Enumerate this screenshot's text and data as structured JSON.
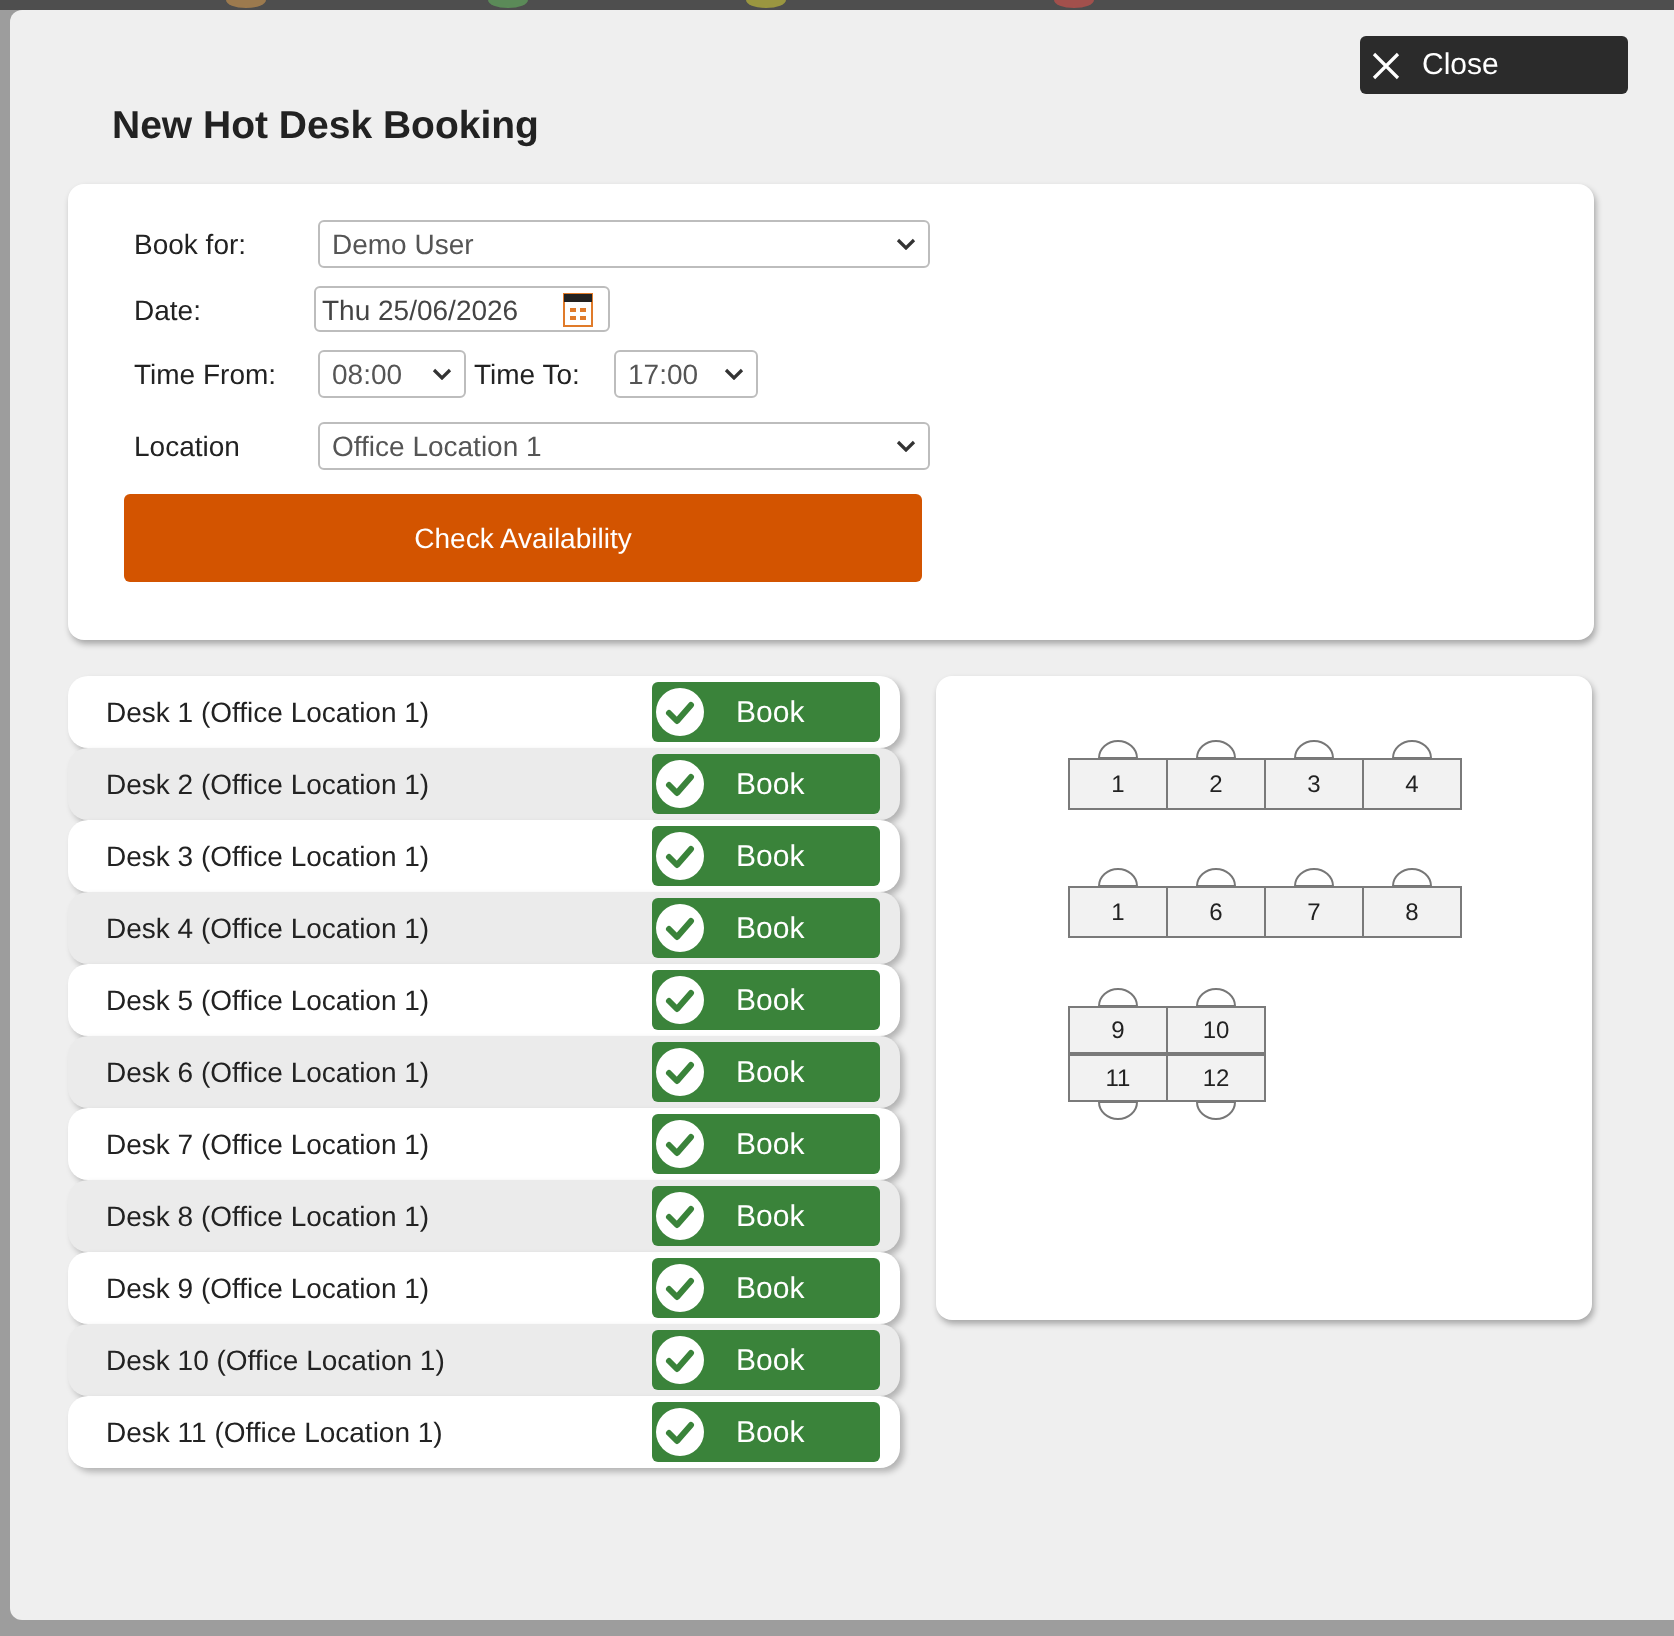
{
  "backdrop": {
    "dots": [
      {
        "color": "#9c7a4e"
      },
      {
        "color": "#5b8a58"
      },
      {
        "color": "#9a9640"
      },
      {
        "color": "#a2504c"
      }
    ]
  },
  "dialog": {
    "close_button": {
      "label": "Close"
    },
    "title": "New Hot Desk Booking"
  },
  "form": {
    "book_for": {
      "label": "Book for:",
      "value": "Demo User"
    },
    "date": {
      "label": "Date:",
      "value": "Thu 25/06/2026"
    },
    "time_from": {
      "label": "Time From:",
      "value": "08:00"
    },
    "time_to": {
      "label": "Time To:",
      "value": "17:00"
    },
    "location": {
      "label": "Location",
      "value": "Office Location 1"
    },
    "check_button": {
      "label": "Check Availability"
    }
  },
  "desks": [
    {
      "name": "Desk 1 (Office Location 1)",
      "action": "Book"
    },
    {
      "name": "Desk 2 (Office Location 1)",
      "action": "Book"
    },
    {
      "name": "Desk 3 (Office Location 1)",
      "action": "Book"
    },
    {
      "name": "Desk 4 (Office Location 1)",
      "action": "Book"
    },
    {
      "name": "Desk 5 (Office Location 1)",
      "action": "Book"
    },
    {
      "name": "Desk 6 (Office Location 1)",
      "action": "Book"
    },
    {
      "name": "Desk 7 (Office Location 1)",
      "action": "Book"
    },
    {
      "name": "Desk 8 (Office Location 1)",
      "action": "Book"
    },
    {
      "name": "Desk 9 (Office Location 1)",
      "action": "Book"
    },
    {
      "name": "Desk 10 (Office Location 1)",
      "action": "Book"
    },
    {
      "name": "Desk 11 (Office Location 1)",
      "action": "Book"
    }
  ],
  "floor_plan": {
    "groups": [
      {
        "rows": [
          [
            {
              "number": "1",
              "kind": "top"
            },
            {
              "number": "2",
              "kind": "top"
            },
            {
              "number": "3",
              "kind": "top"
            },
            {
              "number": "4",
              "kind": "top"
            }
          ]
        ]
      },
      {
        "rows": [
          [
            {
              "number": "1",
              "kind": "top"
            },
            {
              "number": "6",
              "kind": "top"
            },
            {
              "number": "7",
              "kind": "top"
            },
            {
              "number": "8",
              "kind": "top"
            }
          ]
        ]
      },
      {
        "rows": [
          [
            {
              "number": "9",
              "kind": "top"
            },
            {
              "number": "10",
              "kind": "top"
            }
          ],
          [
            {
              "number": "11",
              "kind": "bottom"
            },
            {
              "number": "12",
              "kind": "bottom"
            }
          ]
        ]
      }
    ]
  }
}
